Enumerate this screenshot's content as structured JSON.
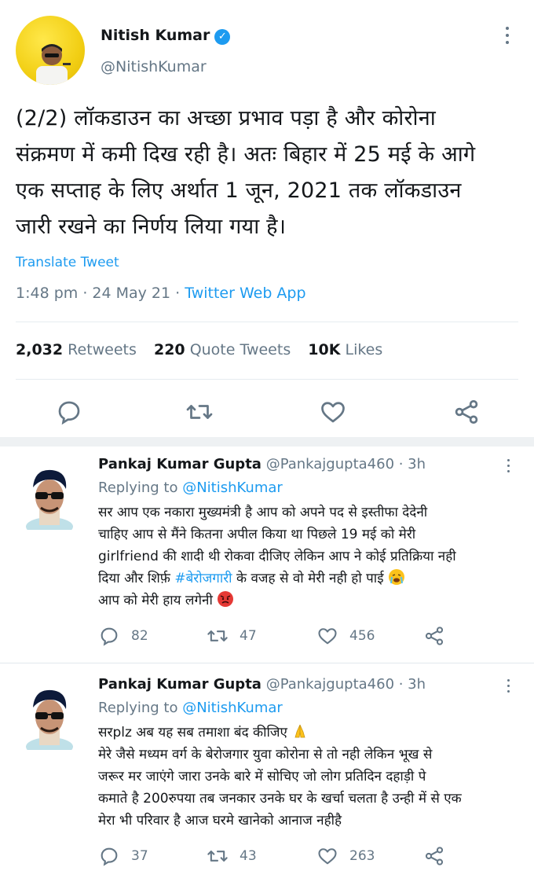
{
  "tweet": {
    "author_name": "Nitish Kumar",
    "verified_glyph": "✓",
    "handle": "@NitishKumar",
    "text_lines": [
      "(2/2) लॉकडाउन का अच्छा प्रभाव पड़ा है और कोरोना",
      "संक्रमण में कमी दिख रही है। अतः बिहार में 25 मई के आगे",
      "एक सप्ताह के लिए अर्थात 1 जून, 2021 तक लॉकडाउन",
      "जारी रखने का निर्णय लिया गया है।"
    ],
    "translate_label": "Translate Tweet",
    "time": "1:48 pm · 24 May 21 · ",
    "source": "Twitter Web App",
    "retweets_count": "2,032",
    "retweets_label": "Retweets",
    "quotes_count": "220",
    "quotes_label": "Quote Tweets",
    "likes_count": "10K",
    "likes_label": "Likes",
    "action_icons": [
      "reply-icon",
      "retweet-icon",
      "like-icon",
      "share-icon"
    ]
  },
  "replies": [
    {
      "author_name": "Pankaj Kumar Gupta",
      "handle_time": "@Pankajgupta460 · 3h",
      "replying_prefix": "Replying to ",
      "replying_handle": "@NitishKumar",
      "lines": [
        "सर आप एक नकारा मुख्यमंत्री है आप को अपने पद से इस्तीफा देदेनी",
        "चाहिए आप से मैंने कितना अपील किया था पिछले 19 मई को मेरी",
        "girlfriend की शादी थी रोकवा दीजिए लेकिन आप ने कोई प्रतिक्रिया नही",
        "दिया और शिर्फ़ ",
        "#बेरोजगारी",
        " के वजह से वो मेरी नही हो पाई ",
        "आप को मेरी हाय लगेनी "
      ],
      "replies_count": "82",
      "retweets_count": "47",
      "likes_count": "456",
      "emoji_icons": [
        "crying-face-icon",
        "angry-face-icon"
      ]
    },
    {
      "author_name": "Pankaj Kumar Gupta",
      "handle_time": "@Pankajgupta460 · 3h",
      "replying_prefix": "Replying to ",
      "replying_handle": "@NitishKumar",
      "lines": [
        "सरplz अब यह सब तमाशा बंद कीजिए ",
        "मेरे जैसे मध्यम वर्ग के बेरोजगार युवा कोरोना से तो नही लेकिन भूख से",
        "जरूर मर जाएंगे जारा उनके बारे में सोचिए जो लोग प्रतिदिन दहाड़ी पे",
        "कमाते है 200रुपया तब जनकार उनके घर के खर्चा चलता है उन्ही में से एक",
        "मेरा भी परिवार है आज घरमे खानेको आनाज नहीहै"
      ],
      "replies_count": "37",
      "retweets_count": "43",
      "likes_count": "263",
      "emoji_icons": [
        "folded-hands-icon"
      ]
    }
  ],
  "colors": {
    "accent": "#1d9bf0",
    "text": "#14171a",
    "muted": "#657786",
    "divider": "#e6ecf0",
    "avatar_bg": "#f2cf15"
  }
}
